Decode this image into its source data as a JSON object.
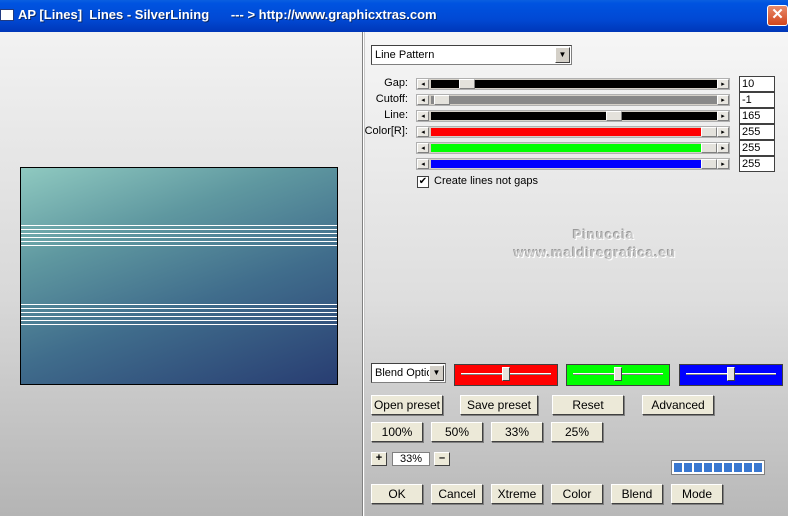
{
  "window": {
    "title": "AP [Lines]  Lines - SilverLining      --- > http://www.graphicxtras.com",
    "close_glyph": "✕"
  },
  "pattern_select": {
    "value": "Line Pattern"
  },
  "sliders": [
    {
      "label": "Gap:",
      "value": "10",
      "track_color": "#000000",
      "level": 0.11
    },
    {
      "label": "Cutoff:",
      "value": "-1",
      "track_color": "#888888",
      "level": 0.02
    },
    {
      "label": "Line:",
      "value": "165",
      "track_color": "#000000",
      "level": 0.65
    },
    {
      "label": "Color[R]:",
      "value": "255",
      "track_color": "#ff0000",
      "level": 1.0
    },
    {
      "label": "",
      "value": "255",
      "track_color": "#00ff00",
      "level": 1.0
    },
    {
      "label": "",
      "value": "255",
      "track_color": "#0000ff",
      "level": 1.0
    }
  ],
  "checkbox": {
    "label": "Create lines not gaps",
    "checked": true,
    "mark": "✔"
  },
  "watermark": {
    "line1": "Pinuccia",
    "line2": "www.maldiregrafica.eu"
  },
  "blend_select": {
    "value": "Blend Optio"
  },
  "color_sliders": [
    {
      "color": "#ff0000",
      "level": 0.5
    },
    {
      "color": "#00ff00",
      "level": 0.5
    },
    {
      "color": "#0000ff",
      "level": 0.5
    }
  ],
  "preset_buttons": [
    "Open preset",
    "Save preset",
    "Reset",
    "Advanced"
  ],
  "zoom_buttons": [
    "100%",
    "50%",
    "33%",
    "25%"
  ],
  "zoom": {
    "plus": "+",
    "value": "33%",
    "minus": "–"
  },
  "bottom_buttons": [
    "OK",
    "Cancel",
    "Xtreme",
    "Color",
    "Blend",
    "Mode"
  ],
  "progress_segments": 9
}
